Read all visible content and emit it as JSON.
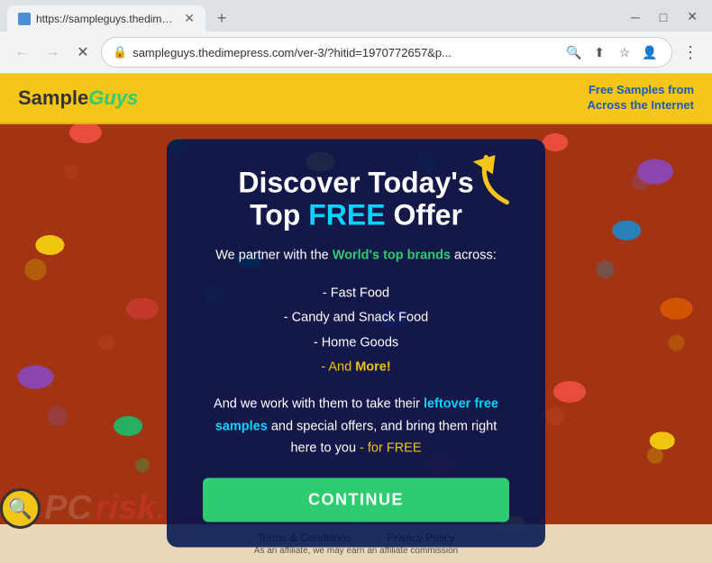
{
  "browser": {
    "tab": {
      "title": "https://sampleguys.thedimepres...",
      "favicon_color": "#4a90d9"
    },
    "address": {
      "url": "sampleguys.thedimepress.com/ver-3/?hitid=1970772657&p...",
      "lock_icon": "🔒"
    },
    "nav": {
      "back": "←",
      "forward": "→",
      "close": "✕"
    },
    "window_controls": {
      "minimize": "─",
      "maximize": "□",
      "close": "✕"
    }
  },
  "header": {
    "logo_sample": "Sample",
    "logo_guys": "Guys",
    "tagline": "Free Samples from Across the Internet"
  },
  "modal": {
    "headline_part1": "Discover Today's",
    "headline_part2": "Top ",
    "headline_free": "FREE",
    "headline_part3": " Offer",
    "subtext_part1": "We partner with the ",
    "subtext_brands": "World's top brands",
    "subtext_part2": " across:",
    "list_items": [
      "- Fast Food",
      "- Candy and Snack Food",
      "- Home Goods",
      "- And More!"
    ],
    "bottom_text_part1": "And we work with them to take their ",
    "bottom_cyan": "leftover free samples",
    "bottom_text_part2": " and special offers, and bring them right here to you ",
    "bottom_yellow": "- for FREE",
    "continue_btn": "CONTINUE"
  },
  "footer": {
    "links": [
      "Terms & Conditions",
      "Privacy Policy"
    ],
    "disclaimer": "As an affiliate, we may earn an affiliate commission"
  },
  "watermark": {
    "icon": "🔍",
    "pc_text": "PC",
    "risk_text": "risk",
    "com": ".com"
  }
}
